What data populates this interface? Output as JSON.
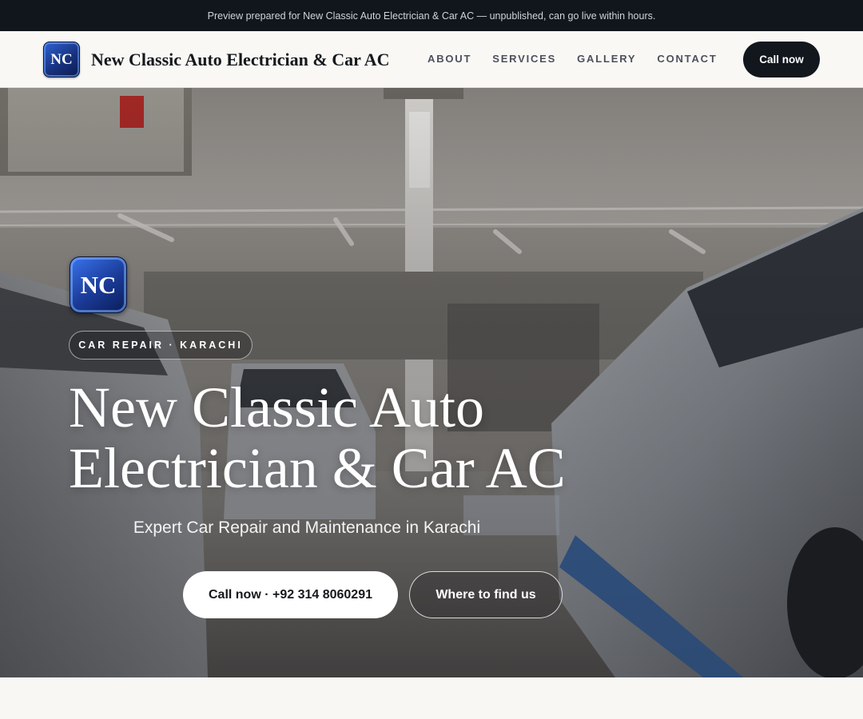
{
  "preview_bar": {
    "text": "Preview prepared for New Classic Auto Electrician & Car AC — unpublished, can go live within hours."
  },
  "header": {
    "logo_text": "NC",
    "brand_name": "New Classic Auto Electrician & Car AC",
    "nav": [
      "ABOUT",
      "SERVICES",
      "GALLERY",
      "CONTACT"
    ],
    "call_button": "Call now"
  },
  "hero": {
    "logo_text": "NC",
    "badge": "CAR REPAIR · KARACHI",
    "title_line1": "New Classic Auto",
    "title_line2": "Electrician & Car AC",
    "subtitle": "Expert Car Repair and Maintenance in Karachi",
    "primary_button": "Call now · +92 314 8060291",
    "secondary_button": "Where to find us"
  },
  "colors": {
    "top_bar": "#11151c",
    "header_bg": "#f9f8f5",
    "dark_button": "#12161d",
    "logo_blue": "#1a3a96"
  },
  "icons": {
    "logo": "nc-logo-badge"
  }
}
